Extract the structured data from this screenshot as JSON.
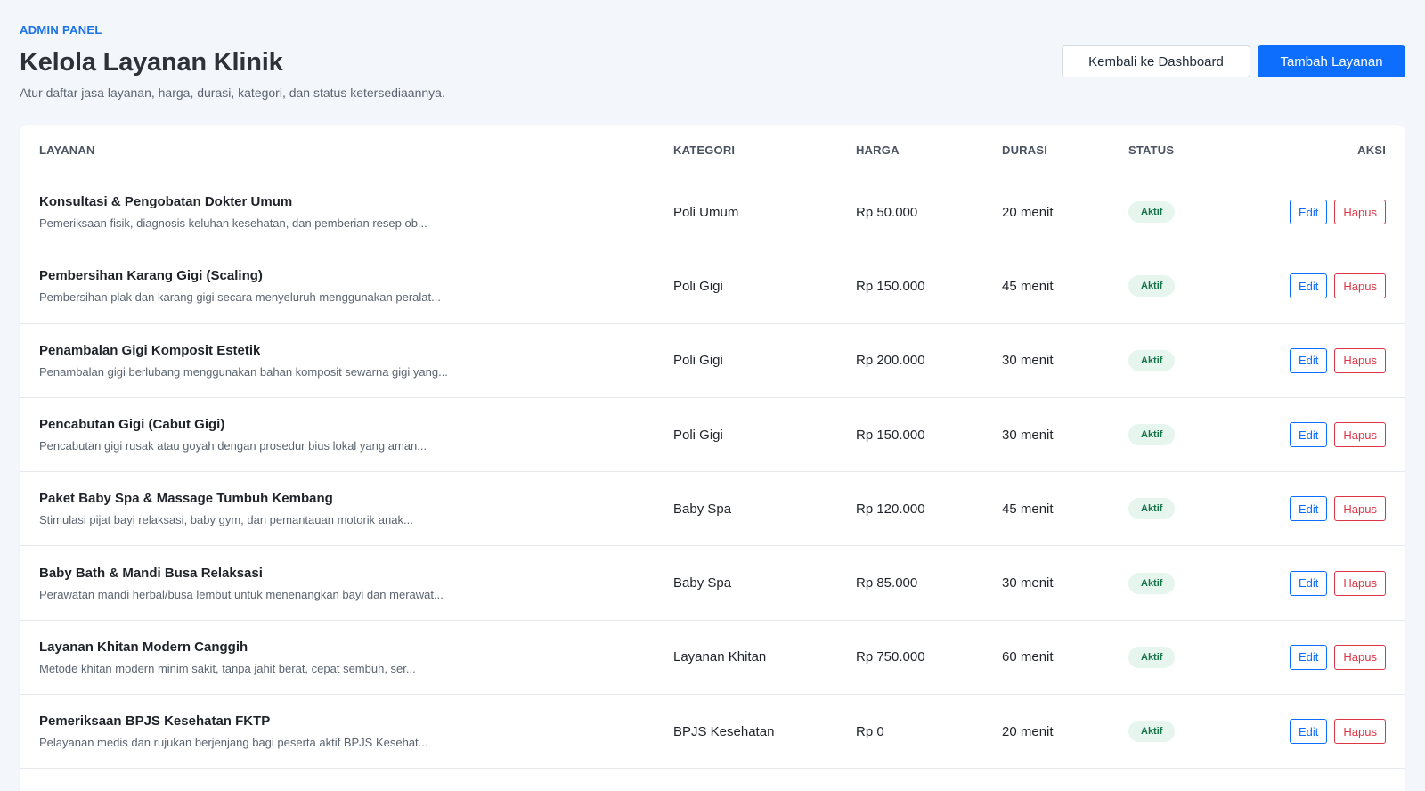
{
  "header": {
    "eyebrow": "ADMIN PANEL",
    "title": "Kelola Layanan Klinik",
    "subtitle": "Atur daftar jasa layanan, harga, durasi, kategori, dan status ketersediaannya.",
    "back_label": "Kembali ke Dashboard",
    "add_label": "Tambah Layanan"
  },
  "colors": {
    "accent": "#0d6efd",
    "danger": "#dc3545",
    "status_active_bg": "#e6f6ee",
    "status_active_text": "#157347"
  },
  "table": {
    "columns": [
      "LAYANAN",
      "KATEGORI",
      "HARGA",
      "DURASI",
      "STATUS",
      "AKSI"
    ],
    "edit_label": "Edit",
    "delete_label": "Hapus",
    "rows": [
      {
        "name": "Konsultasi & Pengobatan Dokter Umum",
        "desc": "Pemeriksaan fisik, diagnosis keluhan kesehatan, dan pemberian resep ob...",
        "category": "Poli Umum",
        "price": "Rp 50.000",
        "duration": "20 menit",
        "status": "Aktif"
      },
      {
        "name": "Pembersihan Karang Gigi (Scaling)",
        "desc": "Pembersihan plak dan karang gigi secara menyeluruh menggunakan peralat...",
        "category": "Poli Gigi",
        "price": "Rp 150.000",
        "duration": "45 menit",
        "status": "Aktif"
      },
      {
        "name": "Penambalan Gigi Komposit Estetik",
        "desc": "Penambalan gigi berlubang menggunakan bahan komposit sewarna gigi yang...",
        "category": "Poli Gigi",
        "price": "Rp 200.000",
        "duration": "30 menit",
        "status": "Aktif"
      },
      {
        "name": "Pencabutan Gigi (Cabut Gigi)",
        "desc": "Pencabutan gigi rusak atau goyah dengan prosedur bius lokal yang aman...",
        "category": "Poli Gigi",
        "price": "Rp 150.000",
        "duration": "30 menit",
        "status": "Aktif"
      },
      {
        "name": "Paket Baby Spa & Massage Tumbuh Kembang",
        "desc": "Stimulasi pijat bayi relaksasi, baby gym, dan pemantauan motorik anak...",
        "category": "Baby Spa",
        "price": "Rp 120.000",
        "duration": "45 menit",
        "status": "Aktif"
      },
      {
        "name": "Baby Bath & Mandi Busa Relaksasi",
        "desc": "Perawatan mandi herbal/busa lembut untuk menenangkan bayi dan merawat...",
        "category": "Baby Spa",
        "price": "Rp 85.000",
        "duration": "30 menit",
        "status": "Aktif"
      },
      {
        "name": "Layanan Khitan Modern Canggih",
        "desc": "Metode khitan modern minim sakit, tanpa jahit berat, cepat sembuh, ser...",
        "category": "Layanan Khitan",
        "price": "Rp 750.000",
        "duration": "60 menit",
        "status": "Aktif"
      },
      {
        "name": "Pemeriksaan BPJS Kesehatan FKTP",
        "desc": "Pelayanan medis dan rujukan berjenjang bagi peserta aktif BPJS Kesehat...",
        "category": "BPJS Kesehatan",
        "price": "Rp 0",
        "duration": "20 menit",
        "status": "Aktif"
      }
    ]
  }
}
